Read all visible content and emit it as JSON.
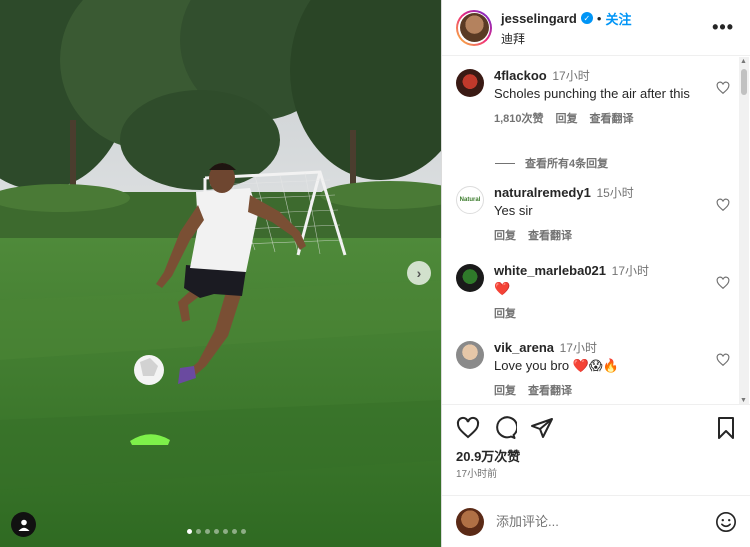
{
  "header": {
    "username": "jesselingard",
    "separator": "•",
    "follow_label": "关注",
    "location": "迪拜",
    "more_label": "•••"
  },
  "media": {
    "next_label": "›",
    "carousel_count": 7,
    "carousel_active": 1
  },
  "comments": [
    {
      "user": "4flackoo",
      "time": "17小时",
      "text": "Scholes punching the air after this",
      "likes": "1,810次赞",
      "reply_label": "回复",
      "translate_label": "查看翻译"
    },
    {
      "user": "naturalremedy1",
      "time": "15小时",
      "text": "Yes sir",
      "reply_label": "回复",
      "translate_label": "查看翻译"
    },
    {
      "user": "white_marleba021",
      "time": "17小时",
      "text": "❤️",
      "reply_label": "回复"
    },
    {
      "user": "vik_arena",
      "time": "17小时",
      "text": "Love you bro ❤️😱🔥",
      "reply_label": "回复",
      "translate_label": "查看翻译"
    }
  ],
  "view_replies_label": "查看所有4条回复",
  "post": {
    "likes": "20.9万次赞",
    "posted": "17小时前"
  },
  "add_comment": {
    "placeholder": "添加评论..."
  },
  "colors": {
    "accent": "#0095f6",
    "secondary_text": "#737373",
    "primary_text": "#262626"
  }
}
